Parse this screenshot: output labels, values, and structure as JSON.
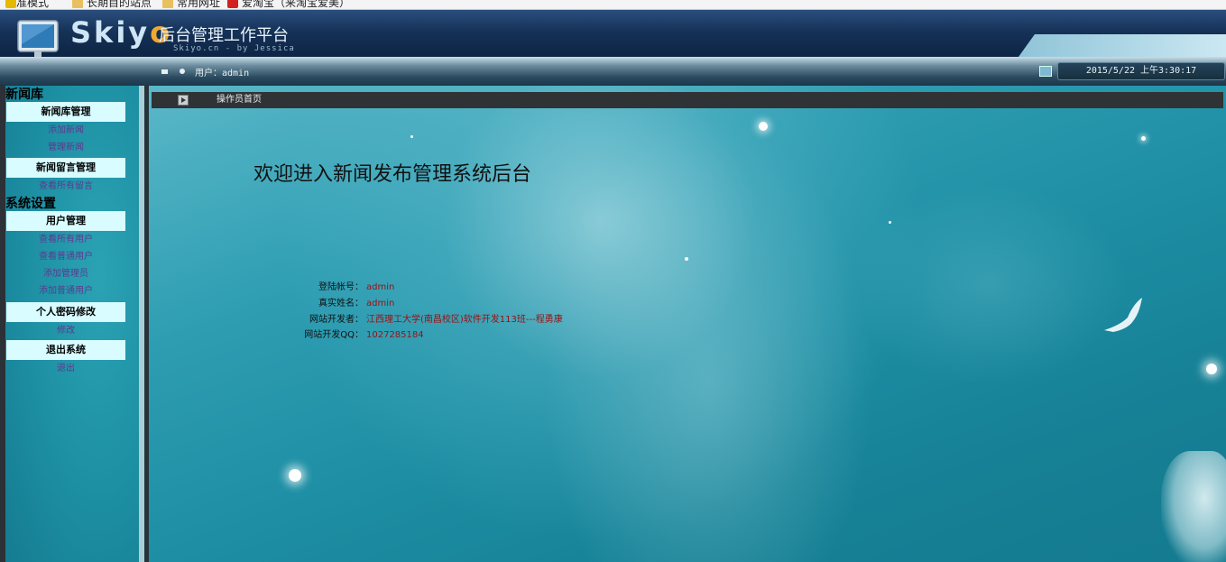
{
  "bookmarks": [
    {
      "label": "标准模式",
      "icon": "star-icon"
    },
    {
      "label": "长期目的站点",
      "icon": "folder-icon"
    },
    {
      "label": "常用网址",
      "icon": "folder-icon"
    },
    {
      "label": "爱淘宝（来淘宝爱美）",
      "icon": "taobao-icon"
    }
  ],
  "header": {
    "logo": {
      "letters_main": "Skiy",
      "letter_accent": "o"
    },
    "platform_name": "后台管理工作平台",
    "platform_sub": "Skiyo.cn - by Jessica"
  },
  "status": {
    "user_text": "用户：admin",
    "datetime": "2015/5/22 上午3:30:17"
  },
  "sidebar": {
    "sections": [
      {
        "title": "新闻库",
        "groups": [
          {
            "label": "新闻库管理",
            "links": [
              "添加新闻",
              "管理新闻"
            ]
          },
          {
            "label": "新闻留言管理",
            "links": [
              "查看所有留言"
            ]
          }
        ]
      },
      {
        "title": "系统设置",
        "groups": [
          {
            "label": "用户管理",
            "links": [
              "查看所有用户",
              "查看普通用户",
              "添加管理员",
              "添加普通用户"
            ]
          },
          {
            "label": "个人密码修改",
            "links": [
              "修改"
            ]
          },
          {
            "label": "退出系统",
            "links": [
              "退出"
            ]
          }
        ]
      }
    ]
  },
  "main": {
    "breadcrumb": "操作员首页",
    "welcome": "欢迎进入新闻发布管理系统后台",
    "info": [
      {
        "label": "登陆帐号：",
        "value": "admin"
      },
      {
        "label": "真实姓名：",
        "value": "admin"
      },
      {
        "label": "网站开发者：",
        "value": "江西理工大学(南昌校区)软件开发113班---程勇康"
      },
      {
        "label": "网站开发QQ：",
        "value": "1027285184"
      }
    ]
  },
  "colors": {
    "sidebar_group_bg": "#d8fcff",
    "sidebar_link": "#5b3a8f",
    "info_value": "#9a1010",
    "crumb_bar": "#2f3336"
  }
}
